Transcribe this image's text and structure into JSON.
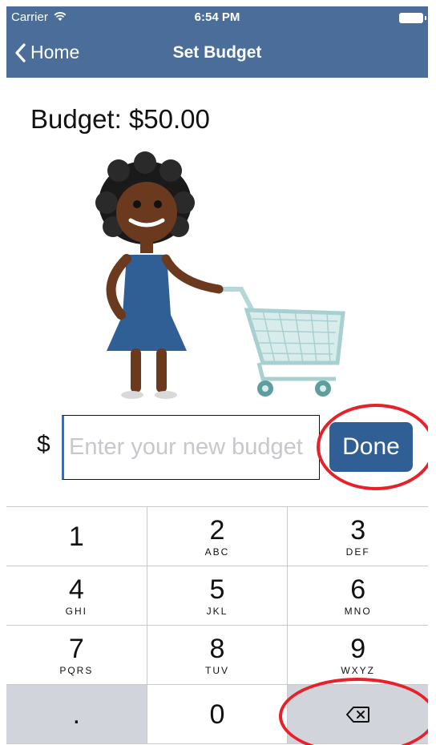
{
  "status_bar": {
    "carrier": "Carrier",
    "time": "6:54 PM"
  },
  "nav": {
    "back_label": "Home",
    "title": "Set Budget"
  },
  "budget": {
    "label": "Budget: $50.00"
  },
  "input": {
    "prefix": "$",
    "placeholder": "Enter your new budget",
    "value": ""
  },
  "done_button": {
    "label": "Done"
  },
  "keypad": {
    "rows": [
      [
        {
          "num": "1",
          "letters": ""
        },
        {
          "num": "2",
          "letters": "ABC"
        },
        {
          "num": "3",
          "letters": "DEF"
        }
      ],
      [
        {
          "num": "4",
          "letters": "GHI"
        },
        {
          "num": "5",
          "letters": "JKL"
        },
        {
          "num": "6",
          "letters": "MNO"
        }
      ],
      [
        {
          "num": "7",
          "letters": "PQRS"
        },
        {
          "num": "8",
          "letters": "TUV"
        },
        {
          "num": "9",
          "letters": "WXYZ"
        }
      ],
      [
        {
          "num": ".",
          "letters": ""
        },
        {
          "num": "0",
          "letters": ""
        },
        {
          "num": "",
          "letters": ""
        }
      ]
    ],
    "delete_icon": "backspace-icon"
  },
  "colors": {
    "nav_bar": "#4a6e99",
    "done_button": "#2f5f95",
    "highlight": "#e8202a",
    "keypad_gray": "#d1d5db"
  }
}
